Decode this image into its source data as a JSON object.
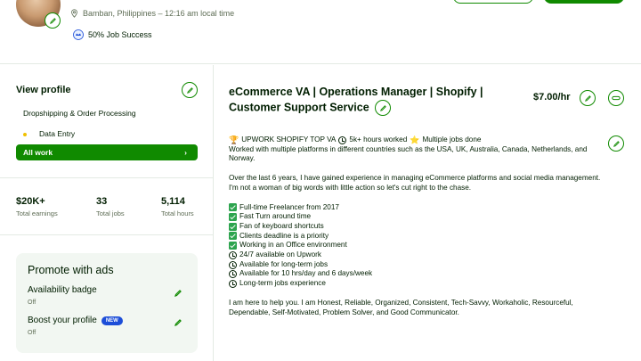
{
  "header": {
    "location": "Bamban, Philippines – 12:16 am local time",
    "job_success": "50% Job Success"
  },
  "sidebar": {
    "view_profile": "View profile",
    "items": [
      {
        "label": "Dropshipping & Order Processing"
      },
      {
        "label": "Data Entry"
      }
    ],
    "all_work": "All work",
    "all_work_arrow": "›",
    "stats": [
      {
        "value": "$20K+",
        "label": "Total earnings"
      },
      {
        "value": "33",
        "label": "Total jobs"
      },
      {
        "value": "5,114",
        "label": "Total hours"
      }
    ],
    "promote": {
      "title": "Promote with ads",
      "availability_label": "Availability badge",
      "availability_status": "Off",
      "boost_label": "Boost your profile",
      "boost_badge": "NEW",
      "boost_status": "Off"
    }
  },
  "main": {
    "title": "eCommerce VA | Operations Manager | Shopify | Customer Support Service",
    "rate": "$7.00/hr",
    "overview": {
      "badge_line_1": "UPWORK SHOPIFY TOP VA",
      "badge_line_2": "5k+ hours worked",
      "badge_line_3": "Multiple jobs done",
      "intro": "Worked with multiple platforms in different countries such as the USA, UK, Australia, Canada, Netherlands, and Norway.",
      "paragraph": "Over the last 6 years, I have gained experience in managing eCommerce platforms and social media management. I'm not a woman of big words with little action so let's cut right to the chase.",
      "checks": [
        "Full-time Freelancer from 2017",
        "Fast Turn around time",
        "Fan of keyboard shortcuts",
        "Clients deadline is a priority",
        "Working in an Office environment"
      ],
      "clocks": [
        "24/7 available on Upwork",
        "Available for long-term jobs",
        "Available for 10 hrs/day and 6 days/week",
        "Long-term jobs experience"
      ],
      "closing": "I am here to help you. I am Honest, Reliable, Organized, Consistent, Tech-Savvy, Workaholic, Resourceful, Dependable, Self-Motivated, Problem Solver, and Good Communicator."
    }
  },
  "colors": {
    "brand_green": "#108a00",
    "text_dark": "#001e00",
    "muted": "#5e6d55",
    "new_badge": "#1d4ed8"
  }
}
